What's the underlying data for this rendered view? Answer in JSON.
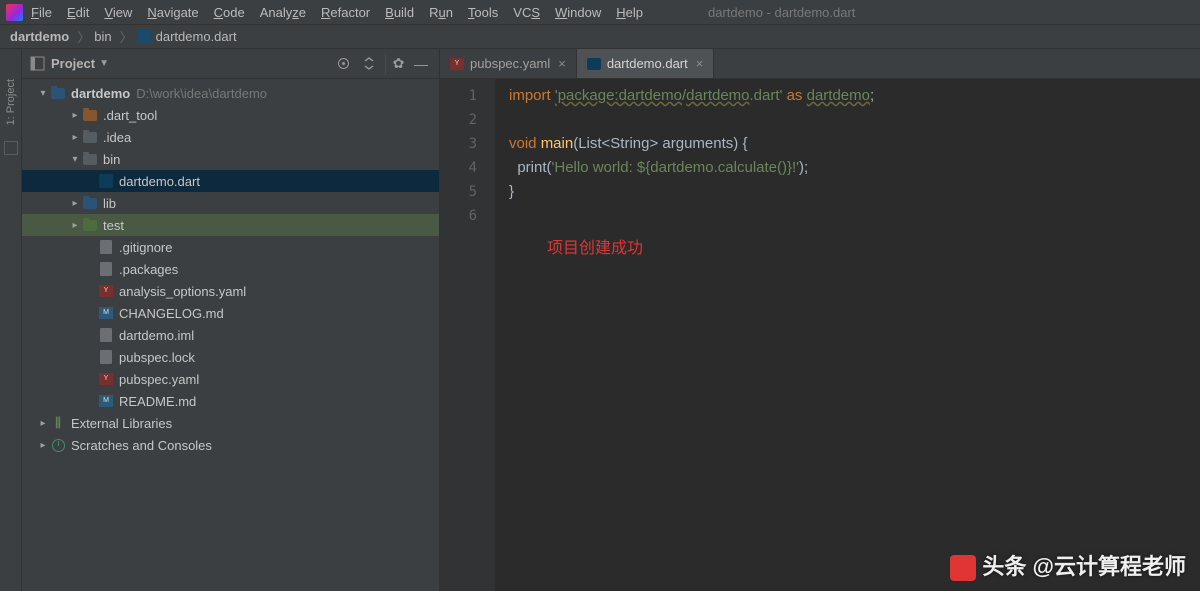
{
  "window": {
    "title": "dartdemo - dartdemo.dart"
  },
  "menu": [
    "File",
    "Edit",
    "View",
    "Navigate",
    "Code",
    "Analyze",
    "Refactor",
    "Build",
    "Run",
    "Tools",
    "VCS",
    "Window",
    "Help"
  ],
  "breadcrumb": {
    "project": "dartdemo",
    "folder": "bin",
    "file": "dartdemo.dart"
  },
  "projectHeader": {
    "label": "Project"
  },
  "tree": {
    "root": {
      "name": "dartdemo",
      "path": "D:\\work\\idea\\dartdemo"
    },
    "items": [
      {
        "name": ".dart_tool",
        "type": "folder-orange",
        "depth": 2,
        "arrow": ">"
      },
      {
        "name": ".idea",
        "type": "folder",
        "depth": 2,
        "arrow": ">"
      },
      {
        "name": "bin",
        "type": "folder",
        "depth": 2,
        "arrow": "v"
      },
      {
        "name": "dartdemo.dart",
        "type": "dart",
        "depth": 3,
        "selected": true
      },
      {
        "name": "lib",
        "type": "folder-blue",
        "depth": 2,
        "arrow": ">"
      },
      {
        "name": "test",
        "type": "folder-green",
        "depth": 2,
        "arrow": ">",
        "hilite": true
      },
      {
        "name": ".gitignore",
        "type": "file",
        "depth": 3
      },
      {
        "name": ".packages",
        "type": "file",
        "depth": 3
      },
      {
        "name": "analysis_options.yaml",
        "type": "yaml",
        "depth": 3
      },
      {
        "name": "CHANGELOG.md",
        "type": "md",
        "depth": 3
      },
      {
        "name": "dartdemo.iml",
        "type": "file",
        "depth": 3
      },
      {
        "name": "pubspec.lock",
        "type": "file",
        "depth": 3
      },
      {
        "name": "pubspec.yaml",
        "type": "yaml",
        "depth": 3
      },
      {
        "name": "README.md",
        "type": "md",
        "depth": 3
      }
    ],
    "ext1": "External Libraries",
    "ext2": "Scratches and Consoles"
  },
  "tabs": [
    {
      "name": "pubspec.yaml",
      "type": "yaml",
      "active": false
    },
    {
      "name": "dartdemo.dart",
      "type": "dart",
      "active": true
    }
  ],
  "code": {
    "lines": [
      1,
      2,
      3,
      4,
      5,
      6
    ],
    "l1_import": "import ",
    "l1_pkg1": "'package:dartdemo",
    "l1_slash": "/",
    "l1_pkg2": "dartdemo",
    "l1_ext": ".dart'",
    "l1_as": " as ",
    "l1_alias": "dartdemo",
    "l1_semi": ";",
    "l3_void": "void ",
    "l3_main": "main",
    "l3_sig": "(List<String> arguments) {",
    "l4_indent": "  print(",
    "l4_str": "'Hello world: ${dartdemo.calculate()}!'",
    "l4_end": ");",
    "l5": "}"
  },
  "overlay": "项目创建成功",
  "watermark": "头条 @云计算程老师",
  "sidebar": {
    "label": "1: Project"
  }
}
